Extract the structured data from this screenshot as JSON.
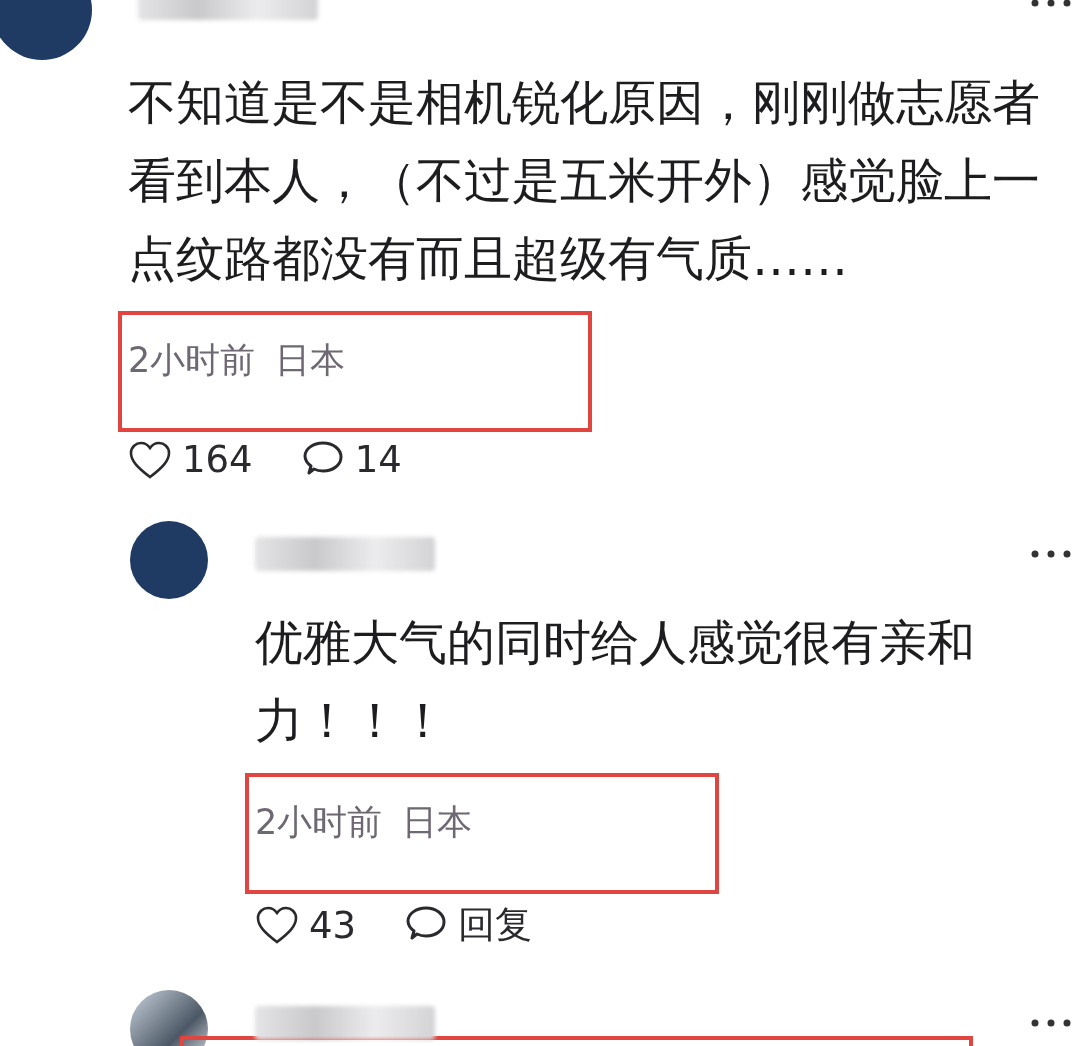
{
  "comments": [
    {
      "kind": "top",
      "avatar": {
        "kind": "plain"
      },
      "text": "不知道是不是相机锐化原因，刚刚做志愿者看到本人，（不过是五米开外）感觉脸上一点纹路都没有而且超级有气质……",
      "time": "2小时前",
      "location": "日本",
      "highlighted": true,
      "likes": "164",
      "replies": "14"
    },
    {
      "kind": "reply",
      "avatar": {
        "kind": "plain"
      },
      "text": "优雅大气的同时给人感觉很有亲和力！！！",
      "time": "2小时前",
      "location": "日本",
      "highlighted": true,
      "likes": "43",
      "reply_label": "回复"
    },
    {
      "kind": "reply",
      "avatar": {
        "kind": "photo"
      },
      "highlighted": true
    }
  ]
}
